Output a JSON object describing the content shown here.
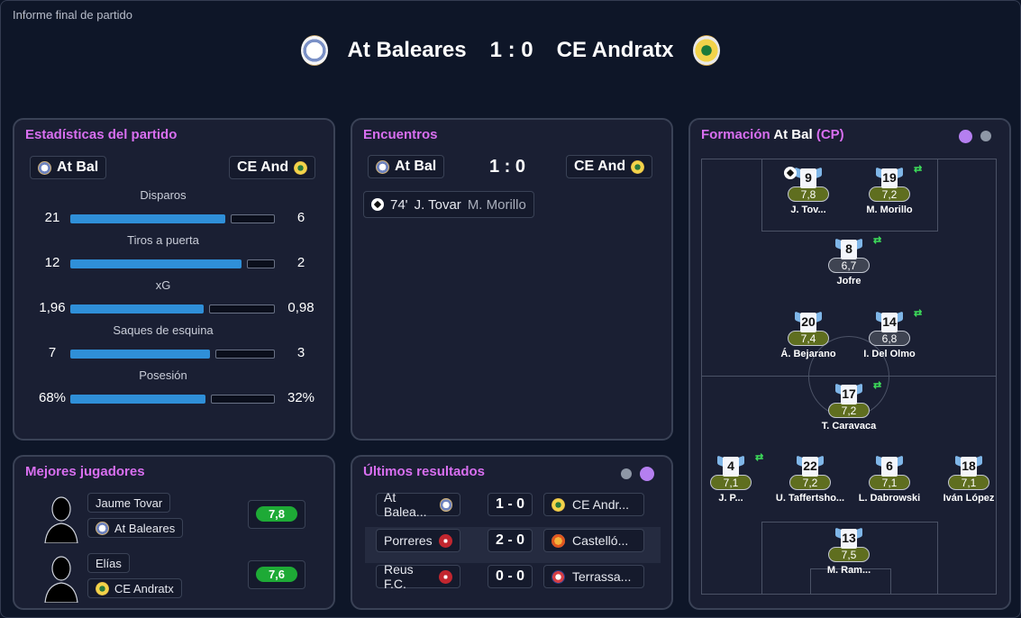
{
  "window": {
    "title": "Informe final de partido"
  },
  "header": {
    "home_team": "At Baleares",
    "score": "1 : 0",
    "away_team": "CE Andratx"
  },
  "stats": {
    "title": "Estadísticas del partido",
    "home_short": "At Bal",
    "away_short": "CE And",
    "rows": [
      {
        "label": "Disparos",
        "home": "21",
        "away": "6",
        "home_fraction": 0.78
      },
      {
        "label": "Tiros a puerta",
        "home": "12",
        "away": "2",
        "home_fraction": 0.86
      },
      {
        "label": "xG",
        "home": "1,96",
        "away": "0,98",
        "home_fraction": 0.67
      },
      {
        "label": "Saques de esquina",
        "home": "7",
        "away": "3",
        "home_fraction": 0.7
      },
      {
        "label": "Posesión",
        "home": "68%",
        "away": "32%",
        "home_fraction": 0.68
      }
    ]
  },
  "encounters": {
    "title": "Encuentros",
    "home_short": "At Bal",
    "score": "1 : 0",
    "away_short": "CE And",
    "goals": [
      {
        "minute": "74'",
        "scorer": "J. Tovar",
        "assist": "M. Morillo"
      }
    ]
  },
  "formation": {
    "title_prefix": "Formación",
    "team": "At Bal",
    "formation": "(CP)",
    "players": [
      {
        "number": "9",
        "rating": "7,8",
        "name": "J. Tov...",
        "rating_color": "olive",
        "goal": true,
        "sub": false
      },
      {
        "number": "19",
        "rating": "7,2",
        "name": "M. Morillo",
        "rating_color": "olive",
        "goal": false,
        "sub": true
      },
      {
        "number": "8",
        "rating": "6,7",
        "name": "Jofre",
        "rating_color": "grey",
        "goal": false,
        "sub": true
      },
      {
        "number": "20",
        "rating": "7,4",
        "name": "Á. Bejarano",
        "rating_color": "olive",
        "goal": false,
        "sub": false
      },
      {
        "number": "14",
        "rating": "6,8",
        "name": "I. Del Olmo",
        "rating_color": "grey",
        "goal": false,
        "sub": true
      },
      {
        "number": "17",
        "rating": "7,2",
        "name": "T. Caravaca",
        "rating_color": "olive",
        "goal": false,
        "sub": true
      },
      {
        "number": "4",
        "rating": "7,1",
        "name": "J. P...",
        "rating_color": "olive",
        "goal": false,
        "sub": true
      },
      {
        "number": "22",
        "rating": "7,2",
        "name": "U. Taffertsho...",
        "rating_color": "olive",
        "goal": false,
        "sub": false
      },
      {
        "number": "6",
        "rating": "7,1",
        "name": "L. Dabrowski",
        "rating_color": "olive",
        "goal": false,
        "sub": false
      },
      {
        "number": "18",
        "rating": "7,1",
        "name": "Iván López",
        "rating_color": "olive",
        "goal": false,
        "sub": false
      },
      {
        "number": "13",
        "rating": "7,5",
        "name": "M. Ram...",
        "rating_color": "olive",
        "goal": false,
        "sub": false
      }
    ]
  },
  "best_players": {
    "title": "Mejores jugadores",
    "players": [
      {
        "name": "Jaume Tovar",
        "team": "At Baleares",
        "rating": "7,8"
      },
      {
        "name": "Elías",
        "team": "CE Andratx",
        "rating": "7,6"
      }
    ]
  },
  "recent_results": {
    "title": "Últimos resultados",
    "rows": [
      {
        "home": "At Balea...",
        "score": "1 - 0",
        "away": "CE Andr..."
      },
      {
        "home": "Porreres",
        "score": "2 - 0",
        "away": "Castelló..."
      },
      {
        "home": "Reus F.C.",
        "score": "0 - 0",
        "away": "Terrassa..."
      }
    ]
  },
  "colors": {
    "accent": "#d86ff0",
    "home_bar": "#2f8fd8",
    "rating_green": "#1eaa36",
    "rating_olive": "#5f6e1f",
    "dot_active": "#b57ff0",
    "dot_inactive": "#8e97a6"
  },
  "icons": {
    "goal": "soccer-ball-icon",
    "substitution": "substitution-arrows-icon",
    "player_silhouette": "player-silhouette-icon"
  }
}
